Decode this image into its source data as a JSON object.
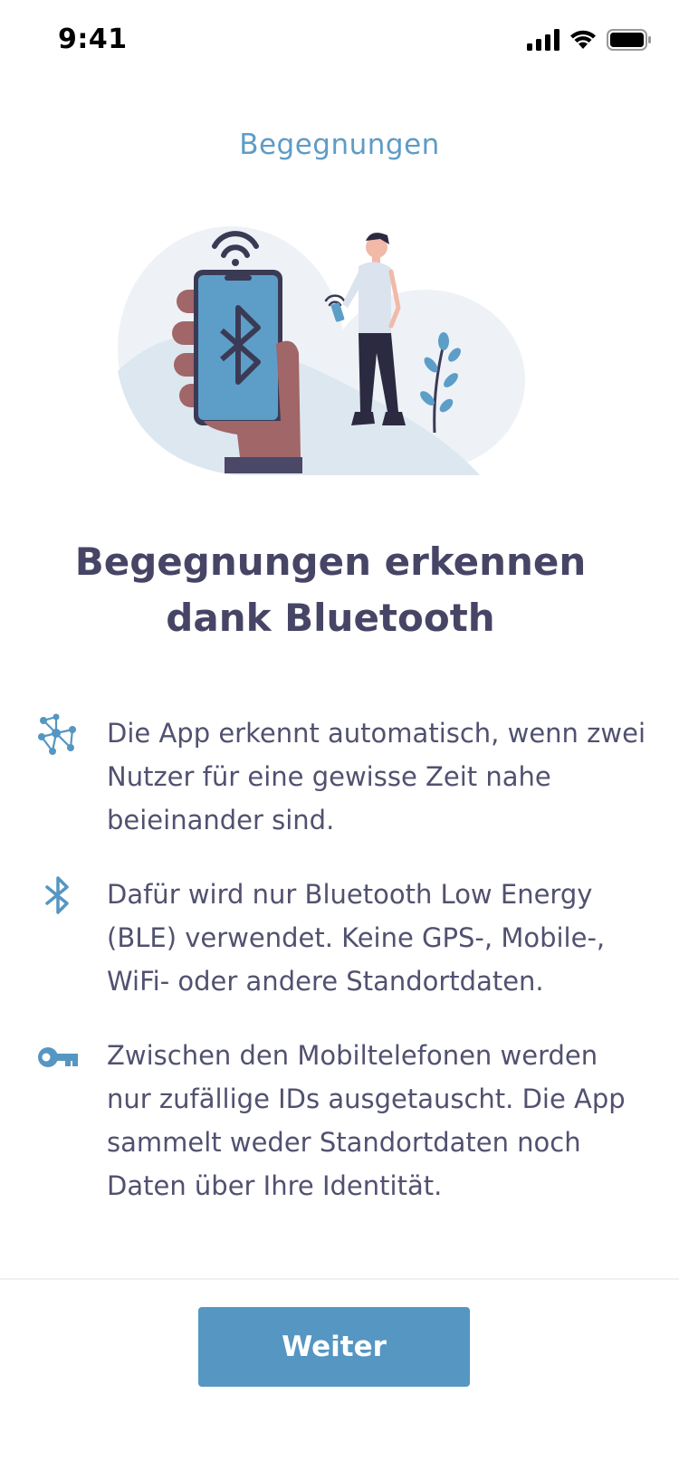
{
  "status_bar": {
    "time": "9:41",
    "icons": [
      "signal-icon",
      "wifi-icon",
      "battery-icon"
    ]
  },
  "header": {
    "title": "Begegnungen"
  },
  "hero": {
    "illustration": "hand-holding-phone-with-bluetooth-and-person-illustration"
  },
  "main": {
    "title_line1": "Begegnungen erkennen",
    "title_line2": "dank Bluetooth"
  },
  "features": [
    {
      "icon": "network-icon",
      "text": "Die App erkennt automatisch, wenn zwei Nutzer für eine gewisse Zeit nahe beieinander sind."
    },
    {
      "icon": "bluetooth-icon",
      "text": "Dafür wird nur Bluetooth Low Energy (BLE) verwendet. Keine GPS-, Mobile-, WiFi- oder andere Standortdaten."
    },
    {
      "icon": "key-icon",
      "text": "Zwischen den Mobiltelefonen werden nur zufällige IDs ausgetauscht. Die App sammelt weder Standortdaten noch Daten über Ihre Identität."
    }
  ],
  "footer": {
    "next_label": "Weiter"
  },
  "colors": {
    "accent": "#5596c2",
    "title": "#474566",
    "header": "#5e9cc6",
    "text": "#515170"
  }
}
